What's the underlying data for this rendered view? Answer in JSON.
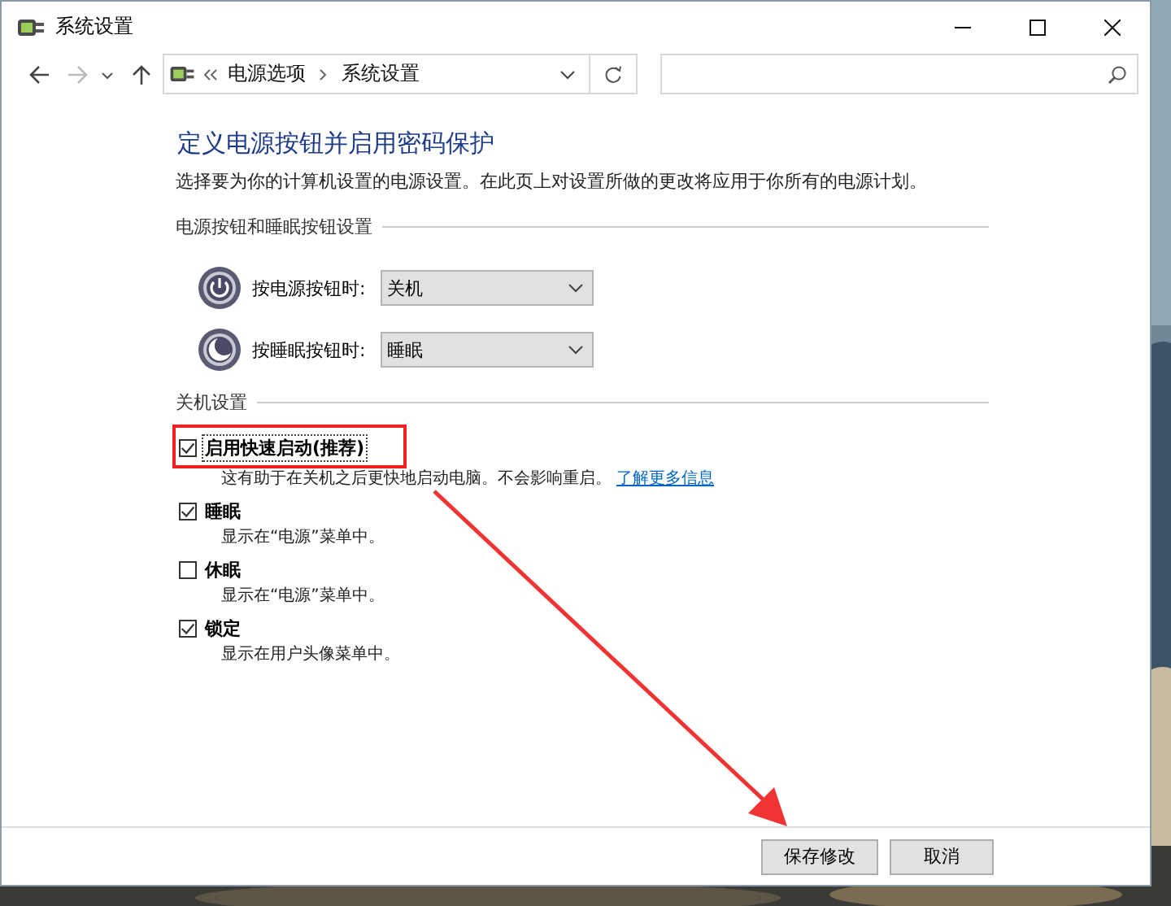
{
  "window": {
    "title": "系统设置"
  },
  "address_bar": {
    "breadcrumbs": [
      "电源选项",
      "系统设置"
    ]
  },
  "heading": "定义电源按钮并启用密码保护",
  "description": "选择要为你的计算机设置的电源设置。在此页上对设置所做的更改将应用于你所有的电源计划。",
  "power_section": {
    "label": "电源按钮和睡眠按钮设置",
    "rows": [
      {
        "kind": "power",
        "label": "按电源按钮时:",
        "value": "关机"
      },
      {
        "kind": "sleep",
        "label": "按睡眠按钮时:",
        "value": "睡眠"
      }
    ]
  },
  "shutdown_section": {
    "label": "关机设置",
    "options": [
      {
        "label": "启用快速启动(推荐)",
        "checked": true,
        "focused": true,
        "description": "这有助于在关机之后更快地启动电脑。不会影响重启。",
        "link": "了解更多信息"
      },
      {
        "label": "睡眠",
        "checked": true,
        "focused": false,
        "description": "显示在“电源”菜单中。"
      },
      {
        "label": "休眠",
        "checked": false,
        "focused": false,
        "description": "显示在“电源”菜单中。"
      },
      {
        "label": "锁定",
        "checked": true,
        "focused": false,
        "description": "显示在用户头像菜单中。"
      }
    ]
  },
  "buttons": [
    "保存修改",
    "取消"
  ]
}
